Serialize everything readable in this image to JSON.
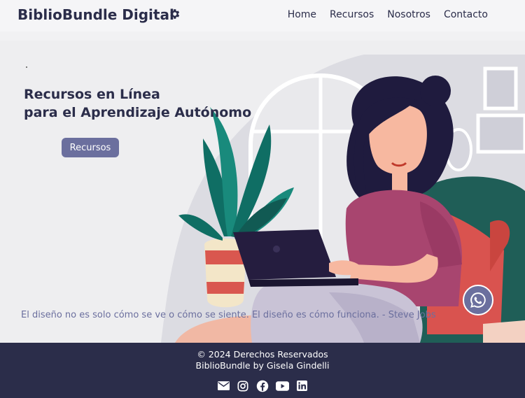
{
  "header": {
    "brand": "BiblioBundle Digital",
    "settings_icon": "gear-icon",
    "nav": [
      {
        "label": "Home"
      },
      {
        "label": "Recursos"
      },
      {
        "label": "Nosotros"
      },
      {
        "label": "Contacto"
      }
    ]
  },
  "hero": {
    "title_line1": "Recursos en Línea",
    "title_line2": "para el Aprendizaje Autónomo",
    "button_label": "Recursos",
    "quote": "El diseño no es solo cómo se ve o cómo se siente. El diseño es cómo funciona. - Steve Jobs",
    "chat_icon": "whatsapp-icon"
  },
  "footer": {
    "copyright": "© 2024 Derechos Reservados",
    "credit": "BiblioBundle by Gisela Gindelli",
    "social": [
      "email-icon",
      "instagram-icon",
      "facebook-icon",
      "youtube-icon",
      "linkedin-icon"
    ]
  },
  "colors": {
    "primary_dark": "#2b2d4a",
    "accent": "#6b6f9e",
    "background": "#eeeef0"
  }
}
